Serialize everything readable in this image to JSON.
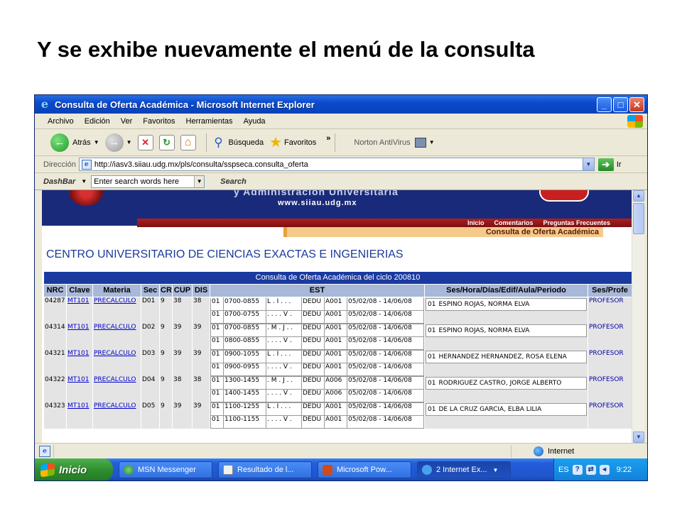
{
  "slide": {
    "title": "Y se exhibe nuevamente el menú de la consulta"
  },
  "window": {
    "title": "Consulta de Oferta Académica - Microsoft Internet Explorer",
    "buttons": {
      "minimize": "_",
      "maximize": "□",
      "close": "✕"
    }
  },
  "menu": [
    "Archivo",
    "Edición",
    "Ver",
    "Favoritos",
    "Herramientas",
    "Ayuda"
  ],
  "toolbar": {
    "back": "Atrás",
    "search": "Búsqueda",
    "favorites": "Favoritos",
    "overflow": "»",
    "norton": "Norton AntiVirus"
  },
  "address": {
    "label": "Dirección",
    "url": "http://iasv3.siiau.udg.mx/pls/consulta/sspseca.consulta_oferta",
    "go": "Ir"
  },
  "dashbar": {
    "logo": "DashBar",
    "placeholder": "Enter search words here",
    "search": "Search"
  },
  "site": {
    "banner_line": "y Administración Universitaria",
    "url": "www.siiau.udg.mx",
    "nav": [
      "Inicio",
      "Comentarios",
      "Preguntas Frecuentes"
    ],
    "subheader": "Consulta de Oferta Académica",
    "centro": "CENTRO UNIVERSITARIO DE CIENCIAS EXACTAS E INGENIERIAS"
  },
  "table": {
    "caption": "Consulta de Oferta Académica del ciclo 200810",
    "headers": [
      "NRC",
      "Clave",
      "Materia",
      "Sec",
      "CR",
      "CUP",
      "DIS",
      "EST",
      "Ses/Hora/Días/Edif/Aula/Periodo",
      "Ses/Profe"
    ],
    "rows": [
      {
        "nrc": "04287",
        "clave": "MT101",
        "materia": "PRECALCULO",
        "sec": "D01",
        "cr": "9",
        "cup": "38",
        "dis": "38",
        "est": [
          {
            "ses": "01",
            "hora": "0700-0855",
            "dias": "L . I . . .",
            "edif": "DEDU",
            "aula": "A001",
            "periodo": "05/02/08 - 14/06/08"
          },
          {
            "ses": "01",
            "hora": "0700-0755",
            "dias": ". . . . V .",
            "edif": "DEDU",
            "aula": "A001",
            "periodo": "05/02/08 - 14/06/08"
          }
        ],
        "prof_ses": "01",
        "profesor": "ESPINO ROJAS, NORMA ELVA",
        "tipo": "PROFESOR"
      },
      {
        "nrc": "04314",
        "clave": "MT101",
        "materia": "PRECALCULO",
        "sec": "D02",
        "cr": "9",
        "cup": "39",
        "dis": "39",
        "est": [
          {
            "ses": "01",
            "hora": "0700-0855",
            "dias": ". M . J . .",
            "edif": "DEDU",
            "aula": "A001",
            "periodo": "05/02/08 - 14/06/08"
          },
          {
            "ses": "01",
            "hora": "0800-0855",
            "dias": ". . . . V .",
            "edif": "DEDU",
            "aula": "A001",
            "periodo": "05/02/08 - 14/06/08"
          }
        ],
        "prof_ses": "01",
        "profesor": "ESPINO ROJAS, NORMA ELVA",
        "tipo": "PROFESOR"
      },
      {
        "nrc": "04321",
        "clave": "MT101",
        "materia": "PRECALCULO",
        "sec": "D03",
        "cr": "9",
        "cup": "39",
        "dis": "39",
        "est": [
          {
            "ses": "01",
            "hora": "0900-1055",
            "dias": "L . I . . .",
            "edif": "DEDU",
            "aula": "A001",
            "periodo": "05/02/08 - 14/06/08"
          },
          {
            "ses": "01",
            "hora": "0900-0955",
            "dias": ". . . . V .",
            "edif": "DEDU",
            "aula": "A001",
            "periodo": "05/02/08 - 14/06/08"
          }
        ],
        "prof_ses": "01",
        "profesor": "HERNANDEZ HERNANDEZ, ROSA ELENA",
        "tipo": "PROFESOR"
      },
      {
        "nrc": "04322",
        "clave": "MT101",
        "materia": "PRECALCULO",
        "sec": "D04",
        "cr": "9",
        "cup": "38",
        "dis": "38",
        "est": [
          {
            "ses": "01",
            "hora": "1300-1455",
            "dias": ". M . J . .",
            "edif": "DEDU",
            "aula": "A006",
            "periodo": "05/02/08 - 14/06/08"
          },
          {
            "ses": "01",
            "hora": "1400-1455",
            "dias": ". . . . V .",
            "edif": "DEDU",
            "aula": "A006",
            "periodo": "05/02/08 - 14/06/08"
          }
        ],
        "prof_ses": "01",
        "profesor": "RODRIGUEZ CASTRO, JORGE ALBERTO",
        "tipo": "PROFESOR"
      },
      {
        "nrc": "04323",
        "clave": "MT101",
        "materia": "PRECALCULO",
        "sec": "D05",
        "cr": "9",
        "cup": "39",
        "dis": "39",
        "est": [
          {
            "ses": "01",
            "hora": "1100-1255",
            "dias": "L . I . . .",
            "edif": "DEDU",
            "aula": "A001",
            "periodo": "05/02/08 - 14/06/08"
          },
          {
            "ses": "01",
            "hora": "1100-1155",
            "dias": ". . . . V .",
            "edif": "DEDU",
            "aula": "A001",
            "periodo": "05/02/08 - 14/06/08"
          }
        ],
        "prof_ses": "01",
        "profesor": "DE LA CRUZ GARCIA, ELBA LILIA",
        "tipo": "PROFESOR"
      }
    ]
  },
  "status": {
    "zone": "Internet"
  },
  "taskbar": {
    "start": "Inicio",
    "tasks": [
      "MSN Messenger",
      "Resultado de l...",
      "Microsoft Pow...",
      "2 Internet Ex..."
    ],
    "lang": "ES",
    "time": "9:22"
  },
  "colors": {
    "titlebar": "#0a4bd0",
    "table_header": "#1a3aa0",
    "banner": "#1a2a7a",
    "taskbar": "#245edb"
  }
}
